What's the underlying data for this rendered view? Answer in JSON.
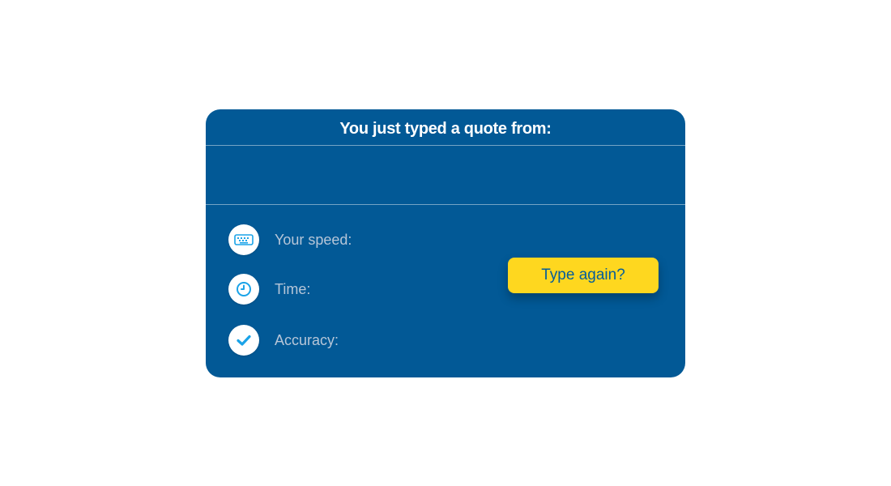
{
  "results_card": {
    "title": "You just typed a quote from:",
    "quote_source": "",
    "stats": [
      {
        "icon": "keyboard-icon",
        "label": "Your speed:",
        "value": ""
      },
      {
        "icon": "clock-icon",
        "label": "Time:",
        "value": ""
      },
      {
        "icon": "checkmark-icon",
        "label": "Accuracy:",
        "value": ""
      }
    ],
    "action_button": "Type again?"
  },
  "colors": {
    "card_background": "#025996",
    "button_background": "#fed71f",
    "button_text": "#035d9b",
    "icon_accent": "#1aa3e8",
    "label_text": "#b7c6d8"
  }
}
